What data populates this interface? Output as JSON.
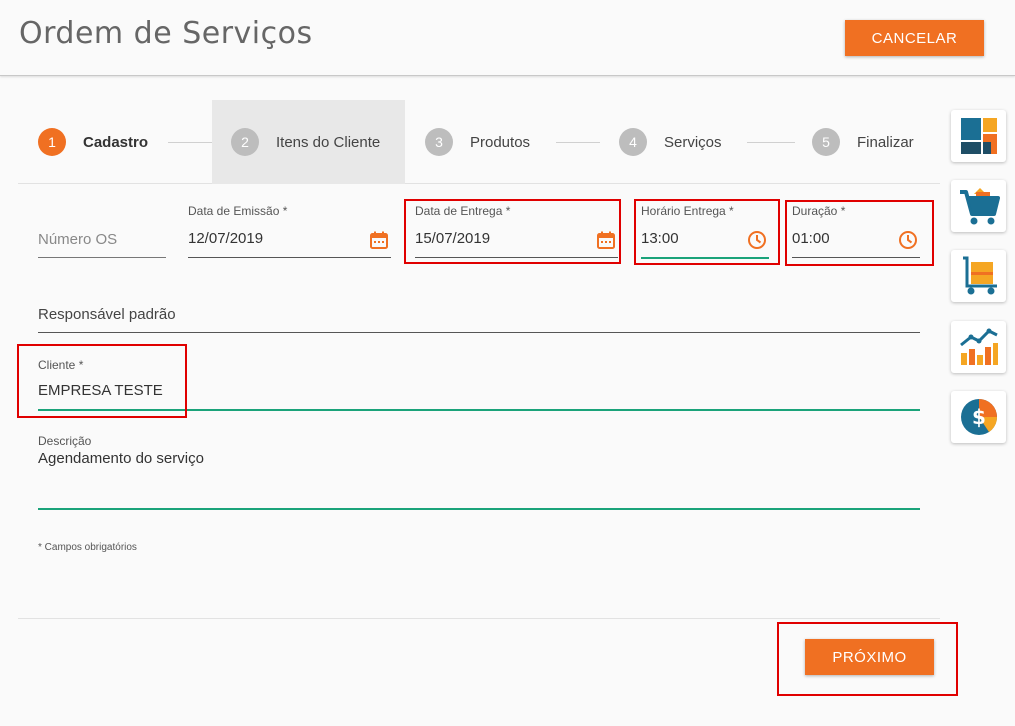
{
  "header": {
    "title": "Ordem de Serviços",
    "cancel_label": "CANCELAR"
  },
  "stepper": {
    "steps": [
      {
        "number": "1",
        "label": "Cadastro"
      },
      {
        "number": "2",
        "label": "Itens do Cliente"
      },
      {
        "number": "3",
        "label": "Produtos"
      },
      {
        "number": "4",
        "label": "Serviços"
      },
      {
        "number": "5",
        "label": "Finalizar"
      }
    ]
  },
  "form": {
    "numero_os": {
      "placeholder": "Número OS"
    },
    "data_emissao": {
      "label": "Data de Emissão *",
      "value": "12/07/2019"
    },
    "data_entrega": {
      "label": "Data de Entrega *",
      "value": "15/07/2019"
    },
    "horario_entrega": {
      "label": "Horário Entrega *",
      "value": "13:00"
    },
    "duracao": {
      "label": "Duração *",
      "value": "01:00"
    },
    "responsavel": {
      "placeholder": "Responsável padrão"
    },
    "cliente": {
      "label": "Cliente *",
      "value": "EMPRESA TESTE"
    },
    "descricao": {
      "label": "Descrição",
      "value": "Agendamento do serviço"
    },
    "required_note": "* Campos obrigatórios"
  },
  "footer": {
    "next_label": "PRÓXIMO"
  },
  "sidebar": {
    "icons": [
      "dashboard-icon",
      "shopping-cart-icon",
      "box-cart-icon",
      "chart-icon",
      "finance-icon"
    ]
  },
  "colors": {
    "accent": "#f07022",
    "focus_green": "#1aa37a",
    "highlight_red": "#e00000"
  }
}
